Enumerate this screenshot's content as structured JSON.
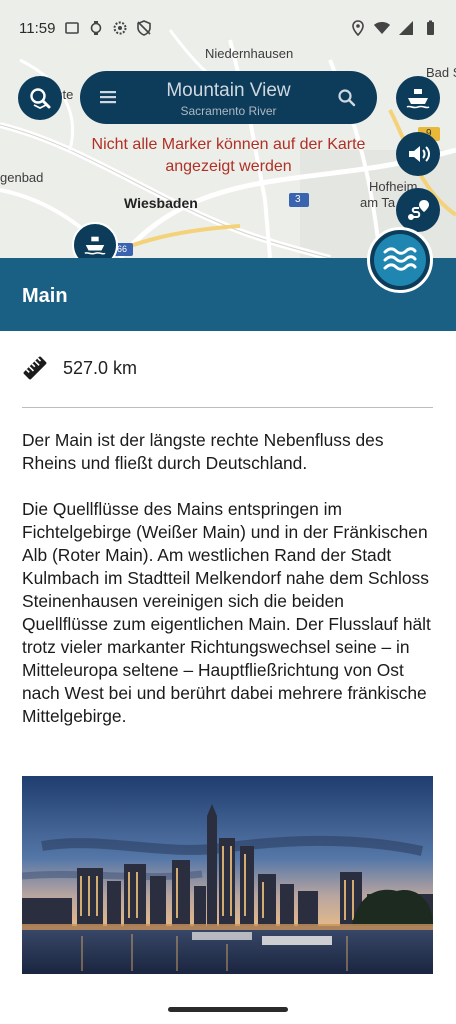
{
  "status": {
    "time": "11:59"
  },
  "map": {
    "labels": {
      "niedernhausen": "Niedernhausen",
      "wiesbaden": "Wiesbaden",
      "hofheim": "Hofheim",
      "am_ta": "am Ta",
      "bad_s": "Bad S",
      "enbad": "genbad",
      "ste": "ste",
      "road_3": "3",
      "road_66": "66",
      "road_9": "9"
    },
    "warning": "Nicht alle Marker können auf der Karte angezeigt werden"
  },
  "search": {
    "title": "Mountain View",
    "subtitle": "Sacramento River"
  },
  "icons": {
    "menu": "menu-icon",
    "search": "search-icon",
    "zoom_search": "map-search-icon",
    "ferry": "ferry-icon",
    "sound": "volume-icon",
    "route": "route-icon",
    "water": "water-waves-icon",
    "ruler": "ruler-icon"
  },
  "colors": {
    "primary": "#0d3b5a",
    "header": "#1a5f84",
    "accent": "#1e86b0",
    "warning": "#b03025"
  },
  "detail": {
    "title": "Main",
    "length": "527.0 km",
    "paragraph1": "Der Main ist der längste rechte Nebenfluss des Rheins und fließt durch Deutschland.",
    "paragraph2": "Die Quellflüsse des Mains entspringen im Fichtelgebirge (Weißer Main) und in der Fränkischen Alb (Roter Main). Am westlichen Rand der Stadt Kulmbach im Stadtteil Melkendorf nahe dem Schloss Steinenhausen vereinigen sich die beiden Quellflüsse zum eigentlichen Main. Der Flusslauf hält trotz vieler markanter Richtungswechsel seine – in Mitteleuropa seltene – Hauptfließrichtung von Ost nach West bei und berührt dabei mehrere fränkische Mittelgebirge."
  }
}
